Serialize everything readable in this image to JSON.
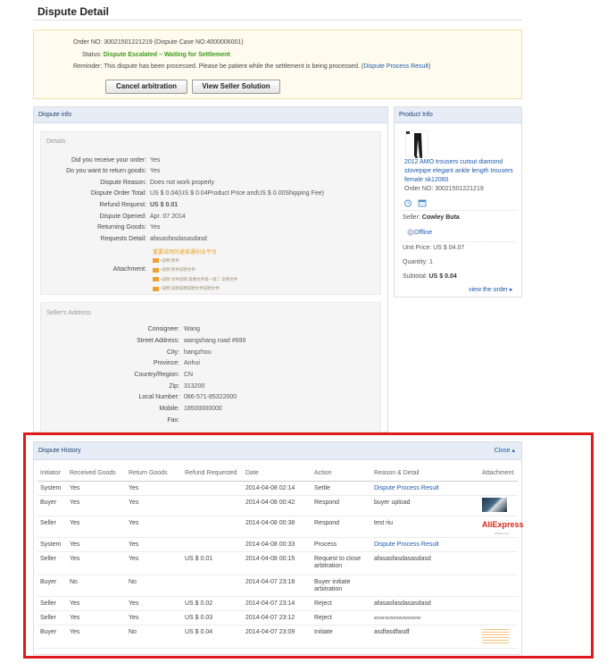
{
  "page": {
    "title": "Dispute Detail"
  },
  "order": {
    "order_no_label": "Order NO:",
    "order_no_value": "30021501221219 (Dispute Case NO:4000006001)",
    "status_label": "Status:",
    "status_value": "Dispute Escalated – Waiting for Settlement",
    "reminder_label": "Reminder:",
    "reminder_text": "This dispute has been processed. Please be patient while the settlement is being processed. (",
    "reminder_link": "Dispute Process Result",
    "reminder_close": ")",
    "buttons": {
      "cancel": "Cancel arbitration",
      "view": "View Seller Solution"
    }
  },
  "dispute_info": {
    "header": "Dispute info",
    "details_title": "Details",
    "rows": [
      {
        "k": "Did you receive your order:",
        "v": "Yes"
      },
      {
        "k": "Do you want to return goods:",
        "v": "Yes"
      },
      {
        "k": "Dispute Reason:",
        "v": "Does not work properly"
      },
      {
        "k": "Dispute Order Total:",
        "v": "US $ 0.04(US $ 0.04Product Price andUS $ 0.00Shipping Fee)"
      },
      {
        "k": "Refund Request:",
        "v": "US $ 0.01"
      },
      {
        "k": "Dispute Opened:",
        "v": "Apr. 07 2014"
      },
      {
        "k": "Returning Goods:",
        "v": "Yes"
      },
      {
        "k": "Requests Detail:",
        "v": "afasasfasdasasdasd"
      }
    ],
    "attachment_label": "Attachment:",
    "attachments": [
      "重要说明的速卖通创业平台",
      "+说明 附件",
      "+说明 附件说明文件",
      "+说明 文件说明 说明文件第一第二 说明文件",
      "+说明 说明说明说明文件说明文件"
    ]
  },
  "seller_address": {
    "title": "Seller's Address",
    "rows": [
      {
        "k": "Consignee:",
        "v": "Wang"
      },
      {
        "k": "Street Address:",
        "v": "wangshang road #699"
      },
      {
        "k": "City:",
        "v": "hangzhou"
      },
      {
        "k": "Province:",
        "v": "Anhui"
      },
      {
        "k": "Country/Region:",
        "v": "CN"
      },
      {
        "k": "Zip:",
        "v": "313200"
      },
      {
        "k": "Local Number:",
        "v": "086-571-85322000"
      },
      {
        "k": "Mobile:",
        "v": "18500000000"
      },
      {
        "k": "Fax:",
        "v": ""
      }
    ]
  },
  "product": {
    "header": "Product Info",
    "title": "2012 AMO trousers cutout diamond stovepipe elegant ankle length trousers female sk12060",
    "order_no": "Order NO: 30021501221219",
    "seller_label": "Seller:",
    "seller_name": "Cowley Buta",
    "status": "Offline",
    "unit_price": "Unit Price:  US $ 04.07",
    "quantity": "Quantity:  1",
    "subtotal_label": "Subtotal:",
    "subtotal_value": "US $ 0.04",
    "view_order": "view the order ▸"
  },
  "history": {
    "header": "Dispute History",
    "close": "Close ▴",
    "columns": [
      "Initiator",
      "Received Goods",
      "Return Goods",
      "Refund Requested",
      "Date",
      "Action",
      "Reason & Detail",
      "Attachment"
    ],
    "rows": [
      {
        "initiator": "System",
        "received": "Yes",
        "returned": "Yes",
        "refund": "",
        "date": "2014-04-08 02:14",
        "action": "Settle",
        "reason": "Dispute Process Result",
        "reason_link": true,
        "attachment": ""
      },
      {
        "initiator": "Buyer",
        "received": "Yes",
        "returned": "Yes",
        "refund": "",
        "date": "2014-04-08 00:42",
        "action": "Respond",
        "reason": "buyer upload",
        "reason_link": false,
        "attachment": "people"
      },
      {
        "initiator": "Seller",
        "received": "Yes",
        "returned": "Yes",
        "refund": "",
        "date": "2014-04-08 00:38",
        "action": "Respond",
        "reason": "test riu",
        "reason_link": false,
        "attachment": "aliexpress"
      },
      {
        "initiator": "System",
        "received": "Yes",
        "returned": "Yes",
        "refund": "",
        "date": "2014-04-08 00:33",
        "action": "Process",
        "reason": "Dispute Process Result",
        "reason_link": true,
        "attachment": ""
      },
      {
        "initiator": "Seller",
        "received": "Yes",
        "returned": "Yes",
        "refund": "US $ 0.01",
        "date": "2014-04-08 00:15",
        "action": "Request to close arbitration",
        "reason": "afasasfasdasasdasd",
        "reason_link": false,
        "attachment": ""
      },
      {
        "initiator": "Buyer",
        "received": "No",
        "returned": "No",
        "refund": "",
        "date": "2014-04-07 23:18",
        "action": "Buyer initiate arbitration",
        "reason": "",
        "reason_link": false,
        "attachment": ""
      },
      {
        "initiator": "Seller",
        "received": "Yes",
        "returned": "Yes",
        "refund": "US $ 0.02",
        "date": "2014-04-07 23:14",
        "action": "Reject",
        "reason": "afasasfasdasasdasd",
        "reason_link": false,
        "attachment": ""
      },
      {
        "initiator": "Seller",
        "received": "Yes",
        "returned": "Yes",
        "refund": "US $ 0.03",
        "date": "2014-04-07 23:12",
        "action": "Reject",
        "reason": "xcvxcvcxvcxvcxvcxvcxv",
        "reason_link": false,
        "attachment": ""
      },
      {
        "initiator": "Buyer",
        "received": "Yes",
        "returned": "No",
        "refund": "US $ 0.04",
        "date": "2014-04-07 23:09",
        "action": "Initiate",
        "reason": "asdfasdfasdf",
        "reason_link": false,
        "attachment": "doc"
      }
    ],
    "aliexpress_text": "AliExpress",
    "aliexpress_sub": "alibaba.com"
  }
}
